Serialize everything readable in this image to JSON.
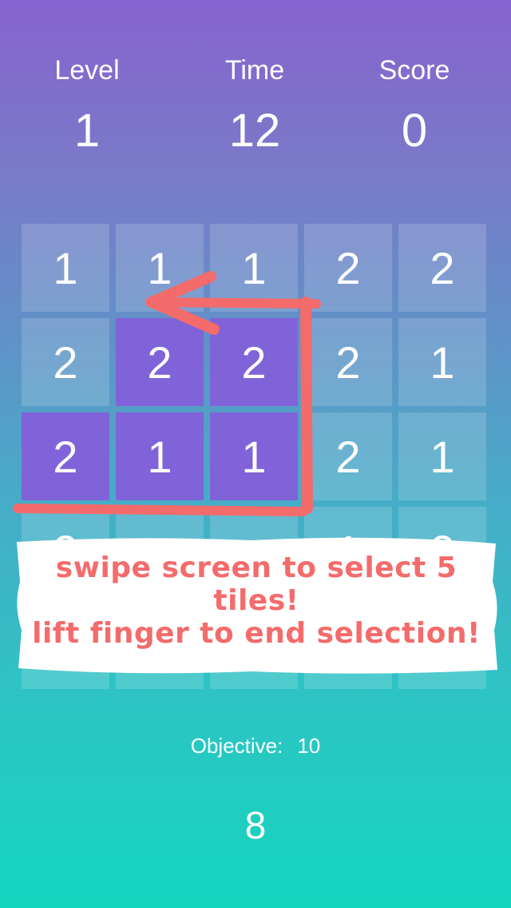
{
  "hud": {
    "level_label": "Level",
    "level_value": "1",
    "time_label": "Time",
    "time_value": "12",
    "score_label": "Score",
    "score_value": "0"
  },
  "board": {
    "rows": [
      [
        "1",
        "1",
        "1",
        "2",
        "2"
      ],
      [
        "2",
        "2",
        "2",
        "2",
        "1"
      ],
      [
        "2",
        "1",
        "1",
        "2",
        "1"
      ],
      [
        "2",
        "",
        "",
        "1",
        "2"
      ],
      [
        "",
        "",
        "",
        "",
        ""
      ]
    ],
    "selected": [
      [
        1,
        1
      ],
      [
        1,
        2
      ],
      [
        2,
        0
      ],
      [
        2,
        1
      ],
      [
        2,
        2
      ]
    ]
  },
  "tutorial": {
    "line1": "swipe screen to select 5 tiles!",
    "line2": "lift finger to end selection!"
  },
  "objective": {
    "label": "Objective:",
    "value": "10"
  },
  "counter": "8",
  "colors": {
    "selected_tile": "#8063d8",
    "tutorial_text": "#f46b6b",
    "arrow": "#f46b6b"
  }
}
